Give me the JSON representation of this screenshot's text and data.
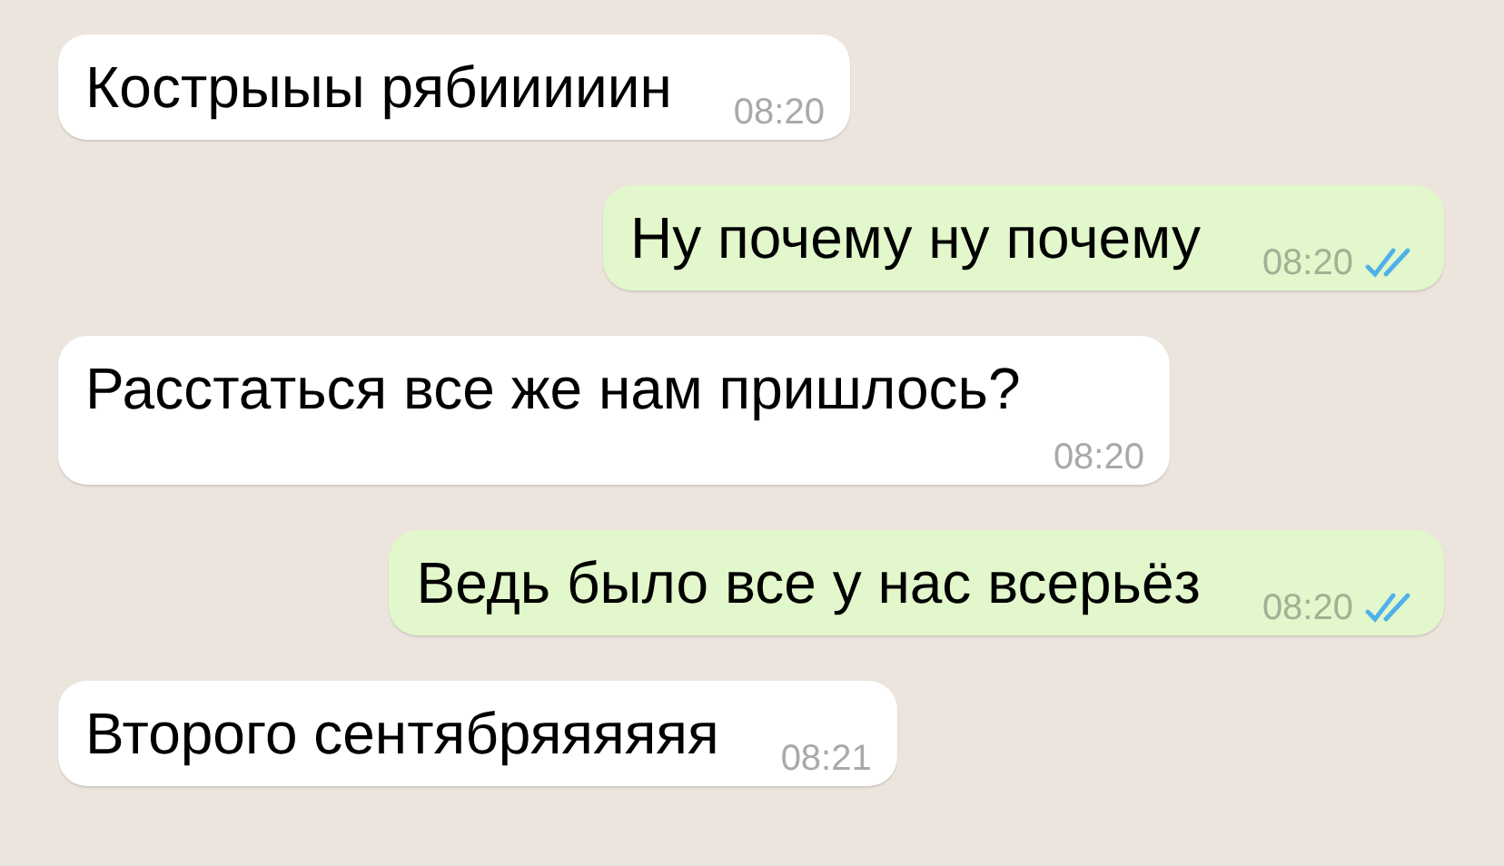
{
  "messages": [
    {
      "kind": "incoming",
      "text": "Кострыыы рябииииин",
      "time": "08:20"
    },
    {
      "kind": "outgoing",
      "text": "Ну почему ну почему",
      "time": "08:20",
      "read": true
    },
    {
      "kind": "incoming",
      "text": "Расстаться все же нам пришлось?",
      "time": "08:20"
    },
    {
      "kind": "outgoing",
      "text": "Ведь было все у нас всерьёз",
      "time": "08:20",
      "read": true
    },
    {
      "kind": "incoming",
      "text": "Второго сентябряяяяяя",
      "time": "08:21"
    }
  ]
}
